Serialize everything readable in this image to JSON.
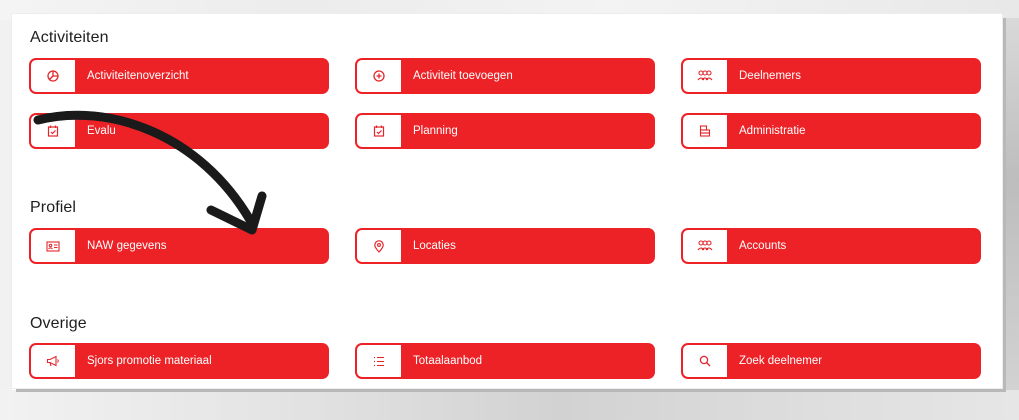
{
  "sections": {
    "activiteiten": {
      "title": "Activiteiten",
      "buttons": [
        {
          "label": "Activiteitenoverzicht",
          "icon": "chart-pie-icon"
        },
        {
          "label": "Activiteit toevoegen",
          "icon": "plus-circle-icon"
        },
        {
          "label": "Deelnemers",
          "icon": "users-icon"
        },
        {
          "label": "Evalu",
          "icon": "calendar-check-icon"
        },
        {
          "label": "Planning",
          "icon": "calendar-check-icon"
        },
        {
          "label": "Administratie",
          "icon": "files-icon"
        }
      ]
    },
    "profiel": {
      "title": "Profiel",
      "buttons": [
        {
          "label": "NAW gegevens",
          "icon": "id-card-icon"
        },
        {
          "label": "Locaties",
          "icon": "map-pin-icon"
        },
        {
          "label": "Accounts",
          "icon": "users-icon"
        }
      ]
    },
    "overige": {
      "title": "Overige",
      "buttons": [
        {
          "label": "Sjors promotie materiaal",
          "icon": "megaphone-icon"
        },
        {
          "label": "Totaalaanbod",
          "icon": "list-icon"
        },
        {
          "label": "Zoek deelnemer",
          "icon": "search-icon"
        }
      ]
    }
  },
  "colors": {
    "accent": "#ec2227",
    "text": "#1f1f1f",
    "arrow": "#1a1a1a"
  }
}
